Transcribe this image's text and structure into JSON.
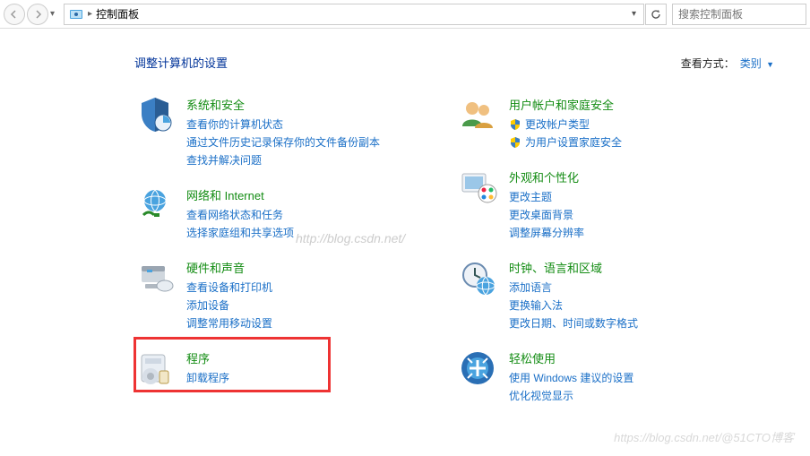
{
  "toolbar": {
    "breadcrumb": "控制面板",
    "search_placeholder": "搜索控制面板"
  },
  "header": {
    "title": "调整计算机的设置",
    "view_label": "查看方式：",
    "view_value": "类别"
  },
  "left": [
    {
      "id": "security",
      "title": "系统和安全",
      "links": [
        {
          "text": "查看你的计算机状态",
          "shield": false
        },
        {
          "text": "通过文件历史记录保存你的文件备份副本",
          "shield": false
        },
        {
          "text": "查找并解决问题",
          "shield": false
        }
      ]
    },
    {
      "id": "network",
      "title": "网络和 Internet",
      "links": [
        {
          "text": "查看网络状态和任务",
          "shield": false
        },
        {
          "text": "选择家庭组和共享选项",
          "shield": false
        }
      ]
    },
    {
      "id": "hardware",
      "title": "硬件和声音",
      "links": [
        {
          "text": "查看设备和打印机",
          "shield": false
        },
        {
          "text": "添加设备",
          "shield": false
        },
        {
          "text": "调整常用移动设置",
          "shield": false
        }
      ]
    },
    {
      "id": "programs",
      "title": "程序",
      "links": [
        {
          "text": "卸载程序",
          "shield": false
        }
      ]
    }
  ],
  "right": [
    {
      "id": "users",
      "title": "用户帐户和家庭安全",
      "links": [
        {
          "text": "更改帐户类型",
          "shield": true
        },
        {
          "text": "为用户设置家庭安全",
          "shield": true
        }
      ]
    },
    {
      "id": "appearance",
      "title": "外观和个性化",
      "links": [
        {
          "text": "更改主题",
          "shield": false
        },
        {
          "text": "更改桌面背景",
          "shield": false
        },
        {
          "text": "调整屏幕分辨率",
          "shield": false
        }
      ]
    },
    {
      "id": "clock",
      "title": "时钟、语言和区域",
      "links": [
        {
          "text": "添加语言",
          "shield": false
        },
        {
          "text": "更换输入法",
          "shield": false
        },
        {
          "text": "更改日期、时间或数字格式",
          "shield": false
        }
      ]
    },
    {
      "id": "ease",
      "title": "轻松使用",
      "links": [
        {
          "text": "使用 Windows 建议的设置",
          "shield": false
        },
        {
          "text": "优化视觉显示",
          "shield": false
        }
      ]
    }
  ],
  "watermark1": "http://blog.csdn.net/",
  "watermark2": "https://blog.csdn.net/@51CTO博客"
}
